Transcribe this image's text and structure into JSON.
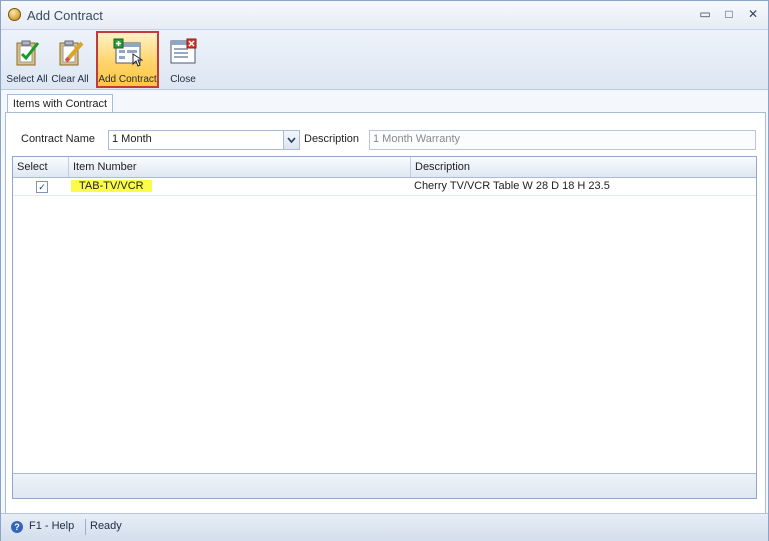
{
  "window": {
    "title": "Add Contract",
    "minimize": "▭",
    "maximize": "□",
    "close": "✕"
  },
  "toolbar": {
    "select_all": "Select All",
    "clear_all": "Clear All",
    "add_contract": "Add Contract",
    "close": "Close"
  },
  "tab": {
    "label": "Items with Contract"
  },
  "form": {
    "contract_name_label": "Contract Name",
    "contract_name_value": "1 Month",
    "description_label": "Description",
    "description_value": "1 Month Warranty"
  },
  "grid": {
    "columns": [
      "Select",
      "Item Number",
      "Description"
    ],
    "rows": [
      {
        "selected": "✓",
        "item_number": "TAB-TV/VCR",
        "description": "Cherry TV/VCR Table  W 28 D 18 H 23.5"
      }
    ]
  },
  "status": {
    "help": "F1 - Help",
    "state": "Ready"
  },
  "colors": {
    "highlight": "#fbfb4c",
    "active_border": "#c23a3a"
  }
}
